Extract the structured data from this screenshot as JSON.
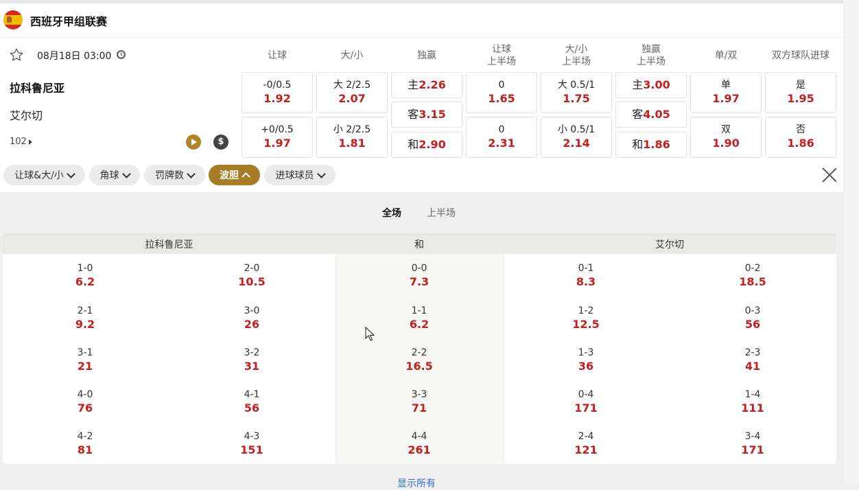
{
  "league": {
    "name": "西班牙甲组联赛"
  },
  "match": {
    "datetime": "08月18日 03:00",
    "home": "拉科鲁尼亚",
    "away": "艾尔切",
    "more_markets": "102"
  },
  "markets": {
    "headers": {
      "handicap": "让球",
      "ou": "大/小",
      "moneyline": "独赢",
      "handicap_half": "让球",
      "handicap_half_sub": "上半场",
      "ou_half": "大/小",
      "ou_half_sub": "上半场",
      "moneyline_half": "独赢",
      "moneyline_half_sub": "上半场",
      "odd_even": "单/双",
      "btts": "双方球队进球"
    },
    "handicap": [
      {
        "line": "-0/0.5",
        "odd": "1.92"
      },
      {
        "line": "+0/0.5",
        "odd": "1.97"
      }
    ],
    "ou": [
      {
        "line": "大 2/2.5",
        "odd": "2.07"
      },
      {
        "line": "小 2/2.5",
        "odd": "1.81"
      }
    ],
    "moneyline": [
      {
        "label": "主",
        "odd": "2.26"
      },
      {
        "label": "客",
        "odd": "3.15"
      },
      {
        "label": "和",
        "odd": "2.90"
      }
    ],
    "handicap_half": [
      {
        "line": "0",
        "odd": "1.65"
      },
      {
        "line": "0",
        "odd": "2.31"
      }
    ],
    "ou_half": [
      {
        "line": "大 0.5/1",
        "odd": "1.75"
      },
      {
        "line": "小 0.5/1",
        "odd": "2.14"
      }
    ],
    "moneyline_half": [
      {
        "label": "主",
        "odd": "3.00"
      },
      {
        "label": "客",
        "odd": "4.05"
      },
      {
        "label": "和",
        "odd": "1.86"
      }
    ],
    "odd_even": [
      {
        "label": "单",
        "odd": "1.97"
      },
      {
        "label": "双",
        "odd": "1.90"
      }
    ],
    "btts": [
      {
        "label": "是",
        "odd": "1.95"
      },
      {
        "label": "否",
        "odd": "1.86"
      }
    ]
  },
  "filters": [
    "让球&大/小",
    "角球",
    "罚牌数",
    "波胆",
    "进球球员"
  ],
  "active_filter": "波胆",
  "period_tabs": [
    "全场",
    "上半场"
  ],
  "active_tab": "全场",
  "correct_score": {
    "headers": {
      "home": "拉科鲁尼亚",
      "draw": "和",
      "away": "艾尔切"
    },
    "home": [
      [
        {
          "score": "1-0",
          "odd": "6.2"
        },
        {
          "score": "2-0",
          "odd": "10.5"
        }
      ],
      [
        {
          "score": "2-1",
          "odd": "9.2"
        },
        {
          "score": "3-0",
          "odd": "26"
        }
      ],
      [
        {
          "score": "3-1",
          "odd": "21"
        },
        {
          "score": "3-2",
          "odd": "31"
        }
      ],
      [
        {
          "score": "4-0",
          "odd": "76"
        },
        {
          "score": "4-1",
          "odd": "56"
        }
      ],
      [
        {
          "score": "4-2",
          "odd": "81"
        },
        {
          "score": "4-3",
          "odd": "151"
        }
      ]
    ],
    "draw": [
      {
        "score": "0-0",
        "odd": "7.3"
      },
      {
        "score": "1-1",
        "odd": "6.2"
      },
      {
        "score": "2-2",
        "odd": "16.5"
      },
      {
        "score": "3-3",
        "odd": "71"
      },
      {
        "score": "4-4",
        "odd": "261"
      }
    ],
    "away": [
      [
        {
          "score": "0-1",
          "odd": "8.3"
        },
        {
          "score": "0-2",
          "odd": "18.5"
        }
      ],
      [
        {
          "score": "1-2",
          "odd": "12.5"
        },
        {
          "score": "0-3",
          "odd": "56"
        }
      ],
      [
        {
          "score": "1-3",
          "odd": "36"
        },
        {
          "score": "2-3",
          "odd": "41"
        }
      ],
      [
        {
          "score": "0-4",
          "odd": "171"
        },
        {
          "score": "1-4",
          "odd": "111"
        }
      ],
      [
        {
          "score": "2-4",
          "odd": "121"
        },
        {
          "score": "3-4",
          "odd": "171"
        }
      ]
    ]
  },
  "show_all": "显示所有",
  "icons": {
    "star": "star-outline-icon",
    "clock": "clock-icon",
    "live": "play-icon",
    "cashout": "dollar-icon",
    "close": "close-icon"
  }
}
